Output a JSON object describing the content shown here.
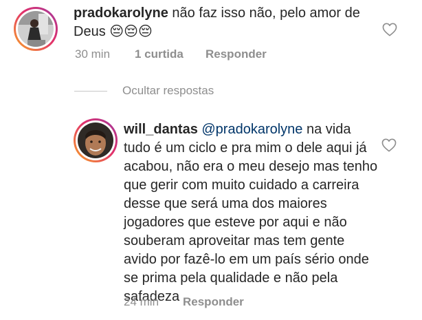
{
  "comment": {
    "username": "pradokarolyne",
    "text": "não faz isso não, pelo amor de Deus 😔😔😔",
    "time": "30 min",
    "likes": "1 curtida",
    "reply": "Responder"
  },
  "toggle_replies": "Ocultar respostas",
  "reply_comment": {
    "username": "will_dantas",
    "mention": "@pradokarolyne",
    "text": "na vida tudo é um ciclo e pra mim o dele aqui já acabou, não era o meu desejo mas tenho que gerir com muito cuidado a carreira desse que será uma dos maiores jogadores que esteve por aqui e não souberam aproveitar mas tem gente avido por fazê-lo em um país sério onde se prima pela qualidade e não pela safadeza",
    "time": "24 min",
    "reply": "Responder"
  },
  "icons": {
    "like": "heart-outline-icon",
    "avatar_ring": "instagram-story-ring"
  },
  "colors": {
    "text": "#262626",
    "muted": "#8e8e8e",
    "mention": "#003569"
  }
}
